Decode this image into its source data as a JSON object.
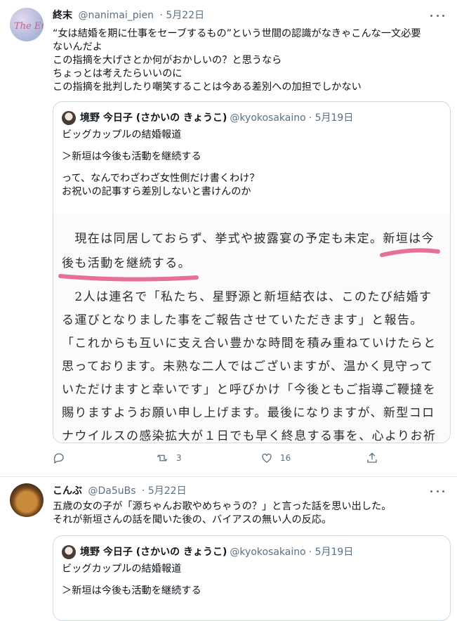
{
  "tweets": [
    {
      "display_name": "終末",
      "handle": "@nanimai_pien",
      "date": "· 5月22日",
      "avatar_text": "The End",
      "text_lines": [
        "“女は結婚を期に仕事をセーブするもの”という世間の認識がなきゃこんな一文必要",
        "ないんだよ",
        "この指摘を大げさとか何がおかしいの？と思うなら",
        "ちょっとは考えたらいいのに",
        "この指摘を批判したり嘲笑することは今ある差別への加担でしかない"
      ],
      "quote": {
        "display_name": "境野 今日子 (さかいの きょうこ)",
        "handle": "@kyokosakaino",
        "date": "· 5月19日",
        "text_lines": [
          "ビッグカップルの結婚報道",
          "",
          "＞新垣は今後も活動を継続する",
          "",
          "って、なんでわざわざ女性側だけ書くわけ？",
          "お祝いの記事すら差別しないと書けんのか"
        ],
        "image_lines": [
          "　現在は同居しておらず、挙式や披露宴の予定も未定。新垣は今",
          "後も活動を継続する。",
          "",
          "　2人は連名で「私たち、星野源と新垣結衣は、このたび結婚す",
          "る運びとなりました事をご報告させていただきます」と報告。",
          "「これからも互いに支え合い豊かな時間を積み重ねていけたらと",
          "思っております。未熟な二人ではございますが、温かく見守って",
          "いただけますと幸いです」と呼びかけ「今後ともご指導ご鞭撻を",
          "賜りますようお願い申し上げます。最後になりますが、新型コロ",
          "ナウイルスの感染拡大が１日でも早く終息する事を、心よりお祈"
        ]
      },
      "actions": {
        "reply": "",
        "retweet": "3",
        "like": "16"
      }
    },
    {
      "display_name": "こんぶ",
      "handle": "@Da5uBs",
      "date": "· 5月22日",
      "text_lines": [
        "五歳の女の子が「源ちゃんお歌やめちゃうの？」と言った話を思い出した。",
        "それが新垣さんの話を聞いた後の、バイアスの無い人の反応。"
      ],
      "quote": {
        "display_name": "境野 今日子 (さかいの きょうこ)",
        "handle": "@kyokosakaino",
        "date": "· 5月19日",
        "text_lines": [
          "ビッグカップルの結婚報道",
          "",
          "＞新垣は今後も活動を継続する"
        ]
      }
    }
  ],
  "colors": {
    "highlight": "#e5709a",
    "muted": "#5b7083",
    "border": "#cfd9de"
  },
  "icons": [
    "more-icon",
    "reply-icon",
    "retweet-icon",
    "like-icon",
    "share-icon"
  ]
}
